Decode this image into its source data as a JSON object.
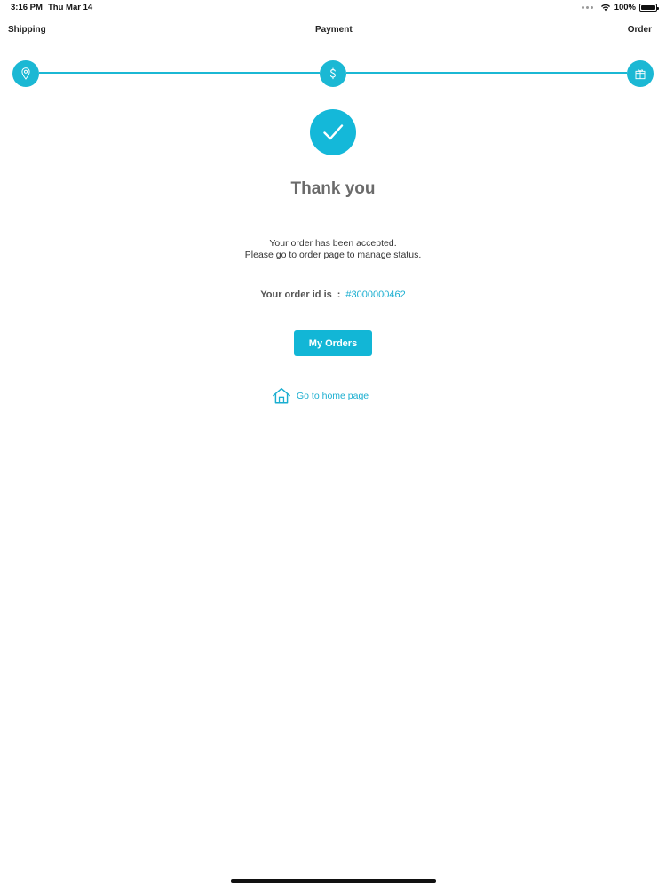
{
  "status_bar": {
    "time": "3:16 PM",
    "date": "Thu Mar 14",
    "battery": "100%",
    "battery_level": 1.0
  },
  "stepper": {
    "steps": [
      {
        "label": "Shipping",
        "icon": "location-pin-icon"
      },
      {
        "label": "Payment",
        "icon": "dollar-icon"
      },
      {
        "label": "Order",
        "icon": "gift-icon"
      }
    ],
    "accent": "#1bb8d4"
  },
  "confirmation": {
    "icon": "checkmark-icon",
    "title": "Thank you",
    "message_line1": "Your order has been accepted.",
    "message_line2": "Please go to order page to manage status.",
    "order_label": "Your order id is",
    "order_separator": ":",
    "order_id": "#3000000462"
  },
  "actions": {
    "my_orders_label": "My Orders",
    "home_link_label": "Go to home page"
  },
  "colors": {
    "accent": "#12b6d6",
    "link": "#1aaed0",
    "title": "#6b6b6b"
  }
}
